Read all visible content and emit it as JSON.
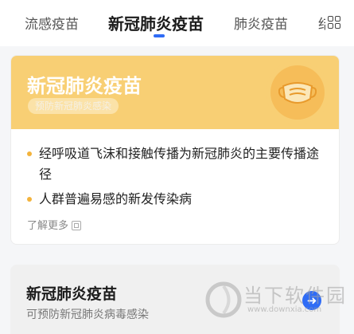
{
  "tabs": [
    {
      "label": "流感疫苗"
    },
    {
      "label": "新冠肺炎疫苗"
    },
    {
      "label": "肺炎疫苗"
    },
    {
      "label": "结"
    }
  ],
  "colors": {
    "accent": "#2f6cf6",
    "card_header": "#f8cf74",
    "bullet": "#f3b33c"
  },
  "card": {
    "title": "新冠肺炎疫苗",
    "tag": "预防新冠肺炎感染",
    "icon": "mask-icon",
    "bullets": [
      "经呼吸道飞沫和接触传播为新冠肺炎的主要传播途径",
      "人群普遍易感的新发传染病"
    ],
    "more": "了解更多"
  },
  "card2": {
    "title": "新冠肺炎疫苗",
    "subtitle": "可预防新冠肺炎病毒感染"
  },
  "watermark": {
    "text": "当下软件园",
    "url": "www.downxia.com"
  }
}
